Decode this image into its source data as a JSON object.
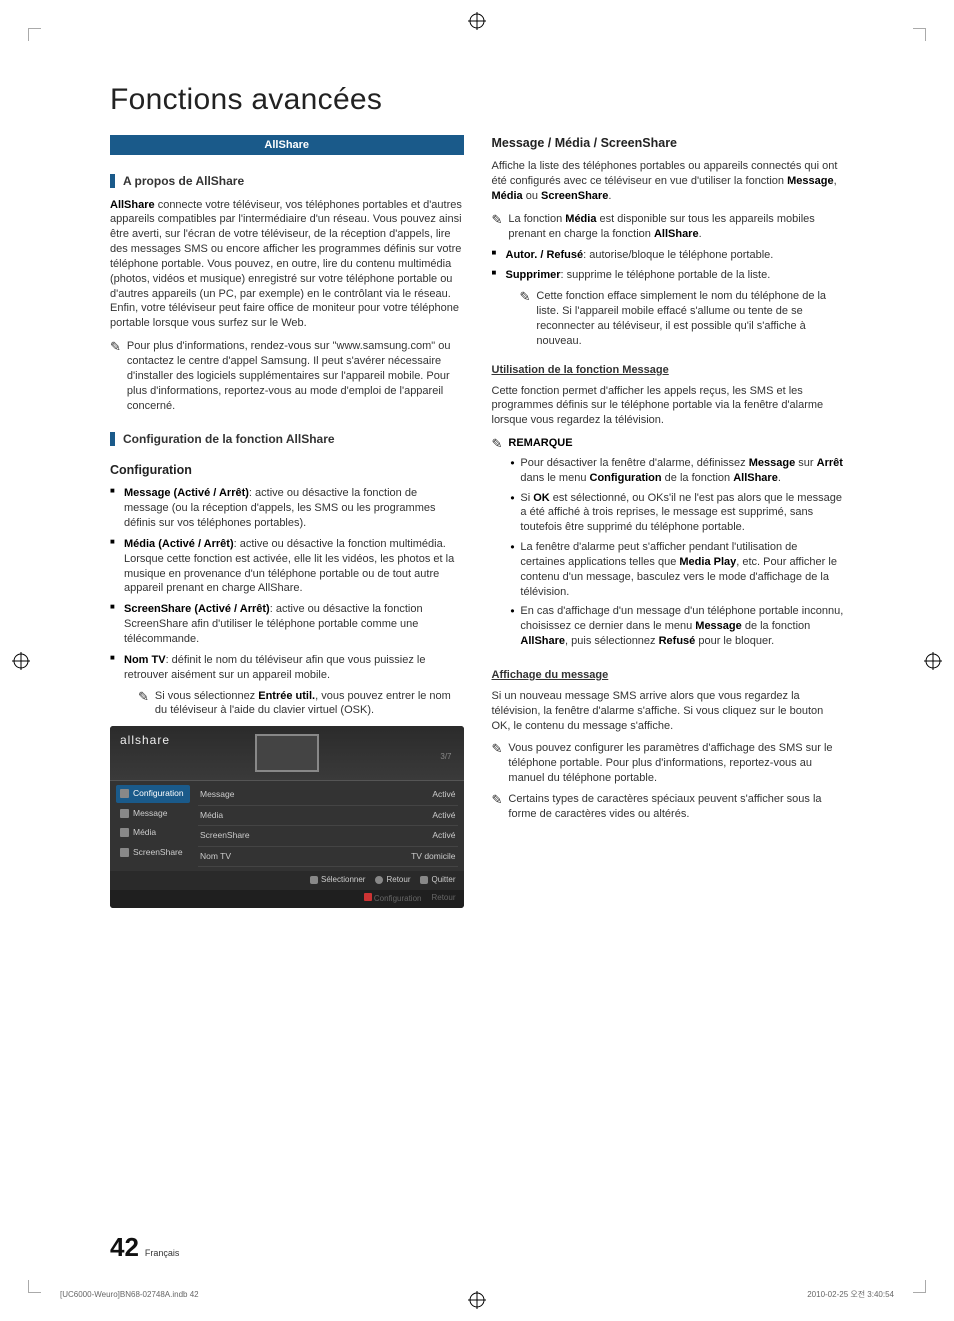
{
  "section_title": "Fonctions avancées",
  "pill": "AllShare",
  "left": {
    "about_heading": "A propos de AllShare",
    "about_para": "AllShare connecte votre téléviseur, vos téléphones portables et d'autres appareils compatibles par l'intermédiaire d'un réseau. Vous pouvez ainsi être averti, sur l'écran de votre téléviseur, de la réception d'appels, lire des messages SMS ou encore afficher les programmes définis sur votre téléphone portable. Vous pouvez, en outre, lire du contenu multimédia (photos, vidéos et musique) enregistré sur votre téléphone portable ou d'autres appareils (un PC, par exemple) en le contrôlant via le réseau. Enfin, votre téléviseur peut faire office de moniteur pour votre téléphone portable lorsque vous surfez sur le Web.",
    "about_note": "Pour plus d'informations, rendez-vous sur \"www.samsung.com\" ou contactez le centre d'appel Samsung. Il peut s'avérer nécessaire d'installer des logiciels supplémentaires sur l'appareil mobile. Pour plus d'informations, reportez-vous au mode d'emploi de l'appareil concerné.",
    "config_bar_heading": "Configuration de la fonction AllShare",
    "config_heading": "Configuration",
    "items": {
      "msg_label": "Message (Activé / Arrêt)",
      "msg_text": ": active ou désactive la fonction de message (ou la réception d'appels, les SMS ou les programmes définis sur vos téléphones portables).",
      "media_label": "Média (Activé / Arrêt)",
      "media_text": ": active ou désactive la fonction multimédia. Lorsque cette fonction est activée, elle lit les vidéos, les photos et la musique en provenance d'un téléphone portable ou de tout autre appareil prenant en charge AllShare.",
      "ss_label": "ScreenShare (Activé / Arrêt)",
      "ss_text": ": active ou désactive la fonction ScreenShare afin d'utiliser le téléphone portable comme une télécommande.",
      "nom_label": "Nom TV",
      "nom_text": ": définit le nom du téléviseur afin que vous puissiez le retrouver aisément sur un appareil mobile.",
      "nom_note": "Si vous sélectionnez Entrée util., vous pouvez entrer le nom du téléviseur à l'aide du clavier virtuel (OSK)."
    }
  },
  "allshare_ui": {
    "logo": "allshare",
    "count": "3/7",
    "side": [
      "Configuration",
      "Message",
      "Média",
      "ScreenShare"
    ],
    "rows": [
      {
        "k": "Message",
        "v": "Activé"
      },
      {
        "k": "Média",
        "v": "Activé"
      },
      {
        "k": "ScreenShare",
        "v": "Activé"
      },
      {
        "k": "Nom TV",
        "v": "TV domicile"
      }
    ],
    "foot": {
      "select": "Sélectionner",
      "return": "Retour",
      "exit": "Quitter"
    },
    "foot2": {
      "a": "Configuration",
      "b": "Retour"
    }
  },
  "right": {
    "heading": "Message / Média / ScreenShare",
    "intro": "Affiche la liste des téléphones portables ou appareils connectés qui ont été configurés avec ce téléviseur en vue d'utiliser la fonction Message, Média ou ScreenShare.",
    "media_note": "La fonction Média est disponible sur tous les appareils mobiles prenant en charge la fonction AllShare.",
    "bullets": {
      "autor_label": "Autor. / Refusé",
      "autor_text": ": autorise/bloque le téléphone portable.",
      "suppr_label": "Supprimer",
      "suppr_text": ": supprime le téléphone portable de la liste.",
      "suppr_note": "Cette fonction efface simplement le nom du téléphone de la liste. Si l'appareil mobile effacé s'allume ou tente de se reconnecter au téléviseur, il est possible qu'il s'affiche à nouveau."
    },
    "use_msg_heading": "Utilisation de la fonction Message",
    "use_msg_para": "Cette fonction permet d'afficher les appels reçus, les SMS et les programmes définis sur le téléphone portable via la fenêtre d'alarme lorsque vous regardez la télévision.",
    "remarque_label": "REMARQUE",
    "remarque_items": [
      "Pour désactiver la fenêtre d'alarme, définissez Message sur Arrêt dans le menu Configuration de la fonction AllShare.",
      "Si OK est sélectionné, ou OKs'il ne l'est pas alors que le message a été affiché à trois reprises, le message est supprimé, sans toutefois être supprimé du téléphone portable.",
      "La fenêtre d'alarme peut s'afficher pendant l'utilisation de certaines applications telles que Media Play, etc. Pour afficher le contenu d'un message, basculez vers le mode d'affichage de la télévision.",
      "En cas d'affichage d'un message d'un téléphone portable inconnu, choisissez ce dernier dans le menu Message de la fonction AllShare, puis sélectionnez Refusé pour le bloquer."
    ],
    "affichage_heading": "Affichage du message",
    "affichage_para": "Si un nouveau message SMS arrive alors que vous regardez la télévision, la fenêtre d'alarme s'affiche. Si vous cliquez sur le bouton OK, le contenu du message s'affiche.",
    "affichage_note1": "Vous pouvez configurer les paramètres d'affichage des SMS sur le téléphone portable. Pour plus d'informations, reportez-vous au manuel du téléphone portable.",
    "affichage_note2": "Certains types de caractères spéciaux peuvent s'afficher sous la forme de caractères vides ou altérés."
  },
  "footer": {
    "page_num": "42",
    "lang": "Français",
    "print_left": "[UC6000-Weuro]BN68-02748A.indb   42",
    "print_right": "2010-02-25   오전 3:40:54"
  }
}
